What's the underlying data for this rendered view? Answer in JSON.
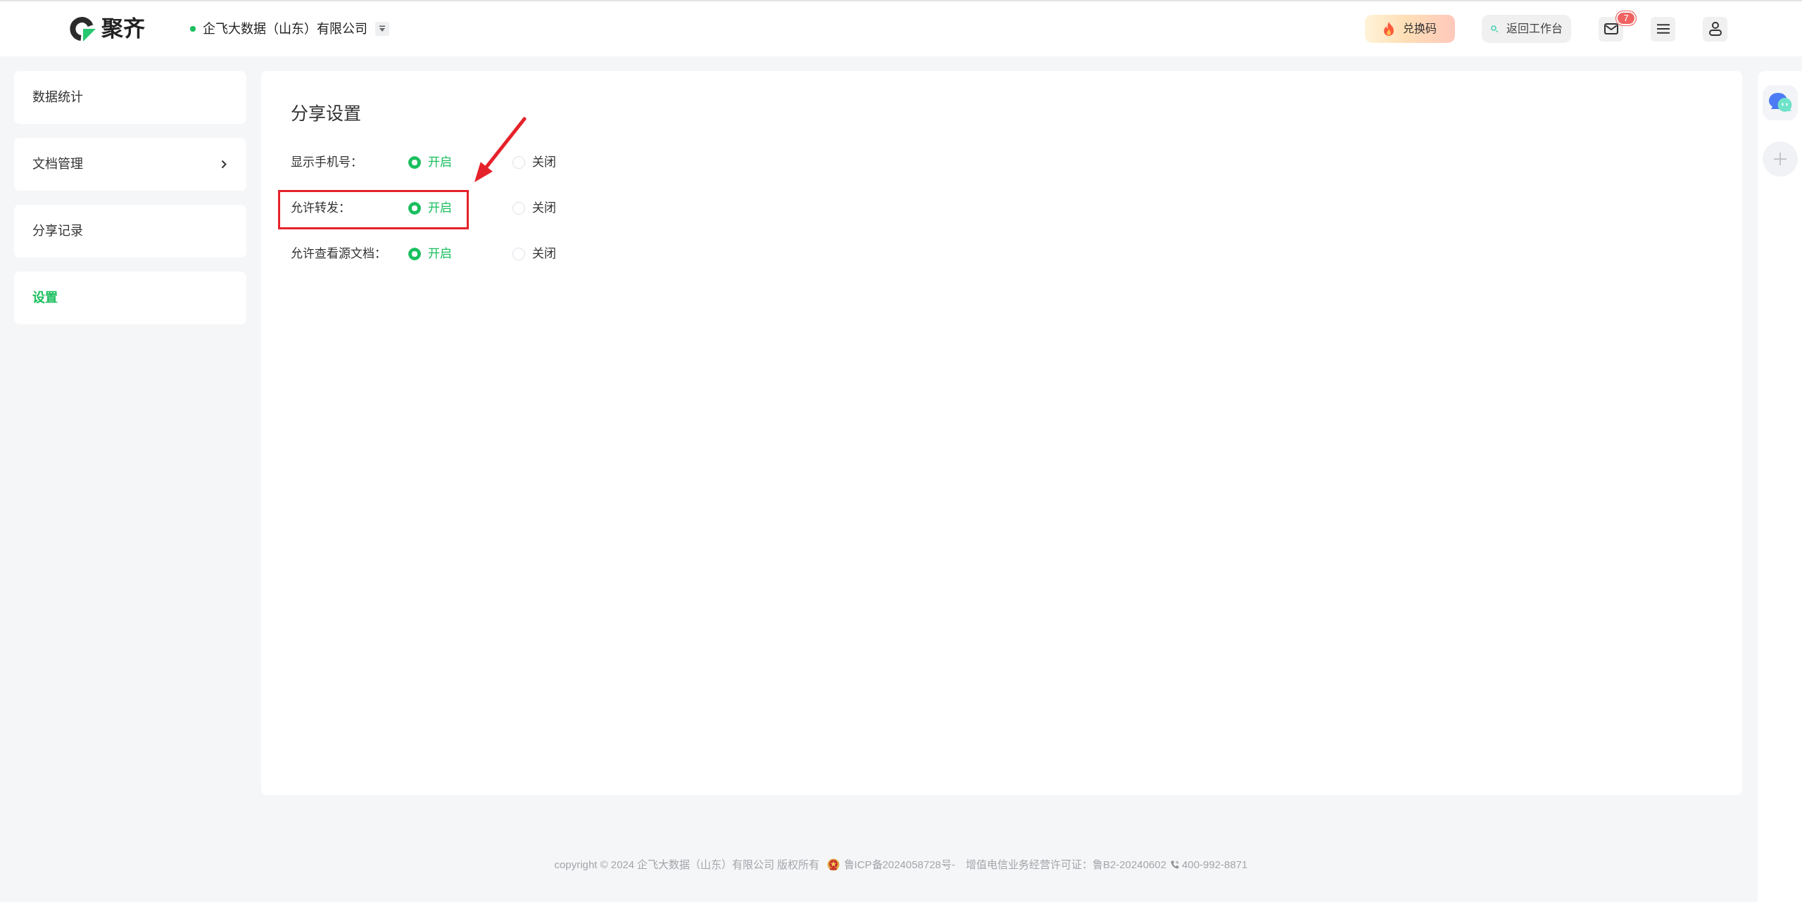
{
  "header": {
    "logo_text": "聚齐",
    "company": "企飞大数据（山东）有限公司",
    "buttons": [
      {
        "kind": "redeem",
        "label": "兑换码"
      },
      {
        "kind": "workbench",
        "label": "返回工作台"
      }
    ],
    "icon_buttons": [
      {
        "kind": "mail",
        "badge": "7"
      },
      {
        "kind": "menu"
      },
      {
        "kind": "user"
      }
    ]
  },
  "sidebar": {
    "items": [
      {
        "label": "数据统计",
        "selected": false,
        "has_submenu": false
      },
      {
        "label": "文档管理",
        "selected": false,
        "has_submenu": true
      },
      {
        "label": "分享记录",
        "selected": false,
        "has_submenu": false
      },
      {
        "label": "设置",
        "selected": true,
        "has_submenu": false
      }
    ]
  },
  "panel": {
    "title": "分享设置",
    "settings": [
      {
        "label": "显示手机号：",
        "highlighted": false,
        "options": [
          {
            "label": "开启",
            "selected": true
          },
          {
            "label": "关闭",
            "selected": false
          }
        ]
      },
      {
        "label": "允许转发：",
        "highlighted": true,
        "options": [
          {
            "label": "开启",
            "selected": true
          },
          {
            "label": "关闭",
            "selected": false
          }
        ]
      },
      {
        "label": "允许查看源文档：",
        "highlighted": false,
        "options": [
          {
            "label": "开启",
            "selected": true
          },
          {
            "label": "关闭",
            "selected": false
          }
        ]
      }
    ]
  },
  "side_toolbar": {
    "items": [
      {
        "kind": "chat"
      },
      {
        "kind": "add"
      }
    ]
  },
  "footer": {
    "copyright": "copyright © 2024 企飞大数据（山东）有限公司 版权所有",
    "icp": "鲁ICP备2024058728号-",
    "license": "增值电信业务经营许可证：鲁B2-20240602",
    "phone": "400-992-8871"
  }
}
